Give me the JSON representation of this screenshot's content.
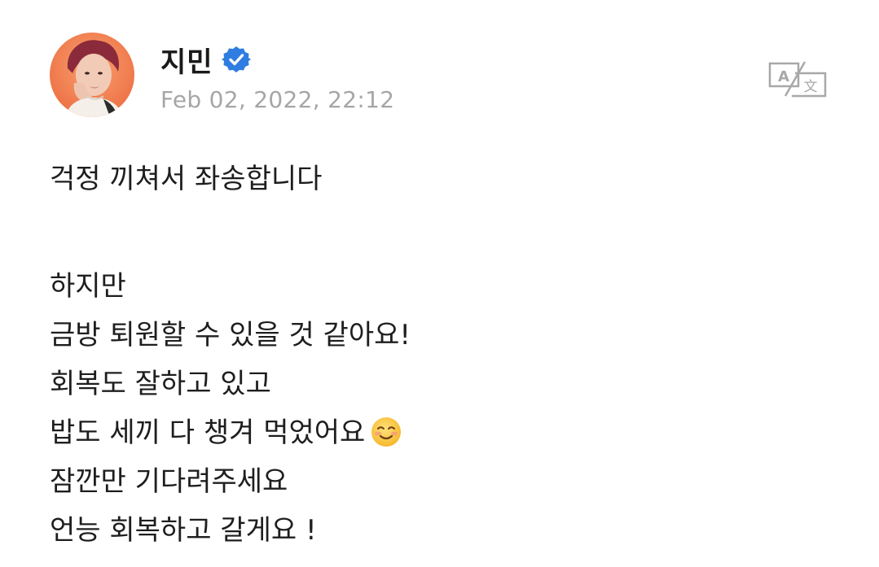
{
  "post": {
    "author": {
      "name": "지민",
      "verified_icon": "verified-badge-icon",
      "avatar_icon": "profile-photo"
    },
    "timestamp": "Feb 02, 2022, 22:12",
    "translate_icon": "translate-icon",
    "body": {
      "line1": "걱정 끼쳐서 좌송합니다",
      "line2": "하지만",
      "line3": "금방 퇴원할 수 있을 것 같아요!",
      "line4": "회복도 잘하고 있고",
      "line5": "밥도 세끼 다 챙겨 먹었어요",
      "line5_emoji": "smiling-face-emoji",
      "line6": "잠깐만 기다려주세요",
      "line7": "언능 회복하고 갈게요 !"
    }
  },
  "colors": {
    "avatar_bg": "#f07a4a",
    "verified_blue": "#2f7de1",
    "timestamp": "#a6a6a6",
    "text": "#1e1e1e",
    "icon_gray": "#a8a8a8"
  }
}
